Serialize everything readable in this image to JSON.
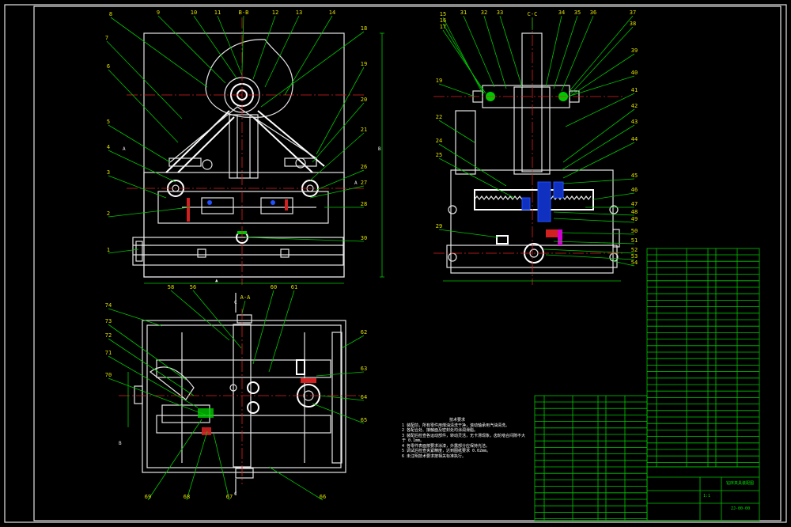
{
  "section_titles": {
    "bb": "B-B",
    "cc": "C-C",
    "aa": "A-A"
  },
  "front_view": {
    "top_numbers": [
      "8",
      "9",
      "10",
      "11",
      "B-B",
      "12",
      "13",
      "14"
    ],
    "left_numbers": [
      "7",
      "6",
      "5",
      "4",
      "3",
      "2",
      "1"
    ],
    "right_numbers": [
      "18",
      "19",
      "20",
      "21",
      "26",
      "27",
      "28",
      "30"
    ],
    "left_letter": "A",
    "right_letter": "A"
  },
  "side_view": {
    "top_numbers": [
      "15",
      "16",
      "17",
      "31",
      "32",
      "33",
      "C-C",
      "34",
      "35",
      "36",
      "37",
      "38"
    ],
    "left_numbers": [
      "19",
      "22",
      "24",
      "25",
      "29"
    ],
    "right_numbers": [
      "39",
      "40",
      "41",
      "42",
      "43",
      "44",
      "45",
      "46",
      "47",
      "48",
      "49",
      "50",
      "51",
      "52",
      "53",
      "54"
    ]
  },
  "plan_view": {
    "top_numbers": [
      "58",
      "56",
      "A-A",
      "60",
      "61"
    ],
    "left_numbers": [
      "74",
      "73",
      "72",
      "71",
      "70"
    ],
    "right_numbers": [
      "62",
      "63",
      "64",
      "65"
    ],
    "bottom_numbers": [
      "69",
      "68",
      "67",
      "66"
    ],
    "section_letter_top": "C",
    "section_letter_bottom": "C",
    "b_letter": "B",
    "b_letter_right": "B"
  },
  "tech_notes": {
    "title": "技术要求",
    "lines": [
      "1 装配前，所有零件用煤油清洗干净，滚动轴承用汽油清洗。",
      "2 各配合处、接触面及密封处均涂润滑脂。",
      "3 装配后检查各运动部件，转动灵活，无卡滞现象，齿轮啮合间隙不大于 0.1mm。",
      "4 各零件表面按要求涂漆，外露部分应保持光洁。",
      "5 调试后检查夹紧精度，达到图纸要求 0.02mm。",
      "6 未注明技术要求按相关标准执行。"
    ]
  },
  "title_block": {
    "drawing_name": "钻床夹具装配图",
    "scale": "1:1",
    "drawing_no": "ZJ-00-00"
  },
  "colors": {
    "background": "#000000",
    "outline": "#e6e6e6",
    "leader": "#00c800",
    "centerline": "#e02020",
    "label": "#e0e000",
    "highlight_blue": "#2050ff",
    "border": "#00c800"
  }
}
